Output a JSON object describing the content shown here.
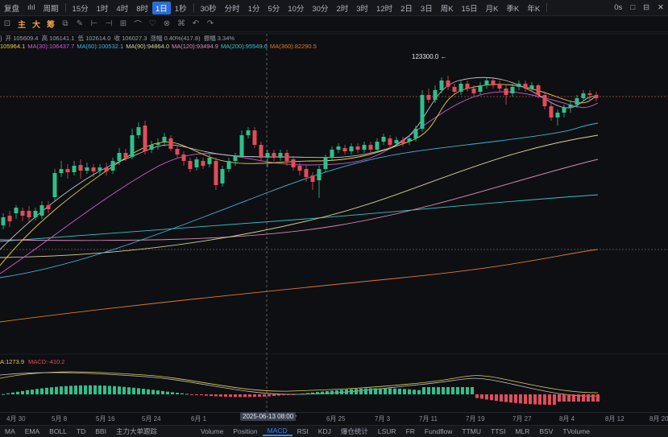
{
  "topbar": {
    "left_items": [
      "复盘",
      "ılıl",
      "周期",
      "15分",
      "1时",
      "4时",
      "8时",
      "1日",
      "1秒",
      "30秒",
      "分时",
      "1分",
      "5分",
      "10分",
      "30分",
      "2时",
      "3时",
      "12时",
      "2日",
      "3日",
      "周K",
      "15日",
      "月K",
      "季K",
      "年K"
    ],
    "active_item": "1日",
    "right_items": [
      "0s",
      "□",
      "⊟",
      "✕"
    ]
  },
  "toolbar": {
    "tools": [
      "⊡",
      "主",
      "大",
      "筹",
      "⧉",
      "✎",
      "⊢",
      "⊣",
      "⊞",
      "⌒",
      "♡",
      "⊗",
      "⌘",
      "↶",
      "↷"
    ],
    "orange_tools": [
      "主",
      "大",
      "筹"
    ]
  },
  "ohlc": {
    "prefix": "}",
    "open": "开 105609.4",
    "high": "高 106141.1",
    "low": "低 102614.0",
    "close": "收 106027.3",
    "change": "涨幅 0.40%(417.8)",
    "amplitude": "振幅 3.34%"
  },
  "ma_legend": [
    {
      "text": "105964.1",
      "color": "#e6d24a"
    },
    {
      "text": "MA(30):106437.7",
      "color": "#d25bd0"
    },
    {
      "text": "MA(60):100532.1",
      "color": "#3fb4e0"
    },
    {
      "text": "MA(90):94864.0",
      "color": "#d8d29a"
    },
    {
      "text": "MA(120):93494.9",
      "color": "#d889b8"
    },
    {
      "text": "MA(200):95549.6",
      "color": "#33c4c8"
    },
    {
      "text": "MA(360):82290.5",
      "color": "#e07a2c"
    }
  ],
  "macd_legend": [
    {
      "text": "A:1273.9",
      "color": "#e6d24a"
    },
    {
      "text": "MACD:-410.2",
      "color": "#e04d5c"
    }
  ],
  "peak_label": "123300.0",
  "crosshair_label": "2025-06-13 08:00",
  "xaxis_ticks": [
    {
      "label": "4月 30"
    },
    {
      "label": "5月 8"
    },
    {
      "label": "5月 16"
    },
    {
      "label": "5月 24"
    },
    {
      "label": "6月 1"
    },
    {
      "label": "7"
    },
    {
      "label": "6月 25"
    },
    {
      "label": "7月 3"
    },
    {
      "label": "7月 11"
    },
    {
      "label": "7月 19"
    },
    {
      "label": "7月 27"
    },
    {
      "label": "8月 4"
    },
    {
      "label": "8月 12"
    },
    {
      "label": "8月 20"
    }
  ],
  "bottombar": {
    "left": [
      "MA",
      "EMA",
      "BOLL",
      "TD",
      "BBI",
      "主力大单跟踪"
    ],
    "right": [
      "Volume",
      "Position",
      "MACD",
      "RSI",
      "KDJ",
      "爆仓统计",
      "LSUR",
      "FR",
      "Fundflow",
      "TTMU",
      "TTSI",
      "MLR",
      "BSV",
      "TVolume"
    ],
    "active": "MACD"
  },
  "colors": {
    "up": "#2ec08c",
    "down": "#e24c5a",
    "accent": "#2a6dd8"
  }
}
